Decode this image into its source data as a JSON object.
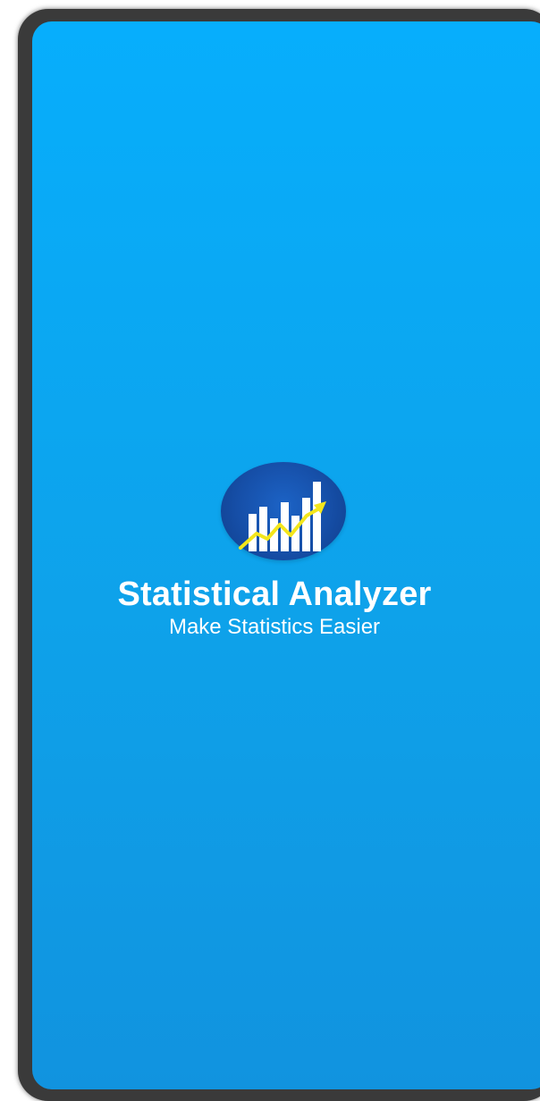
{
  "splash": {
    "app_name": "Statistical Analyzer",
    "tagline": "Make Statistics Easier",
    "logo_icon": "bar-chart-trend-icon"
  },
  "colors": {
    "background_top": "#07aefc",
    "background_bottom": "#1193df",
    "logo_circle": "#164fa8",
    "trend_line": "#f4e61a",
    "bars": "#ffffff"
  }
}
